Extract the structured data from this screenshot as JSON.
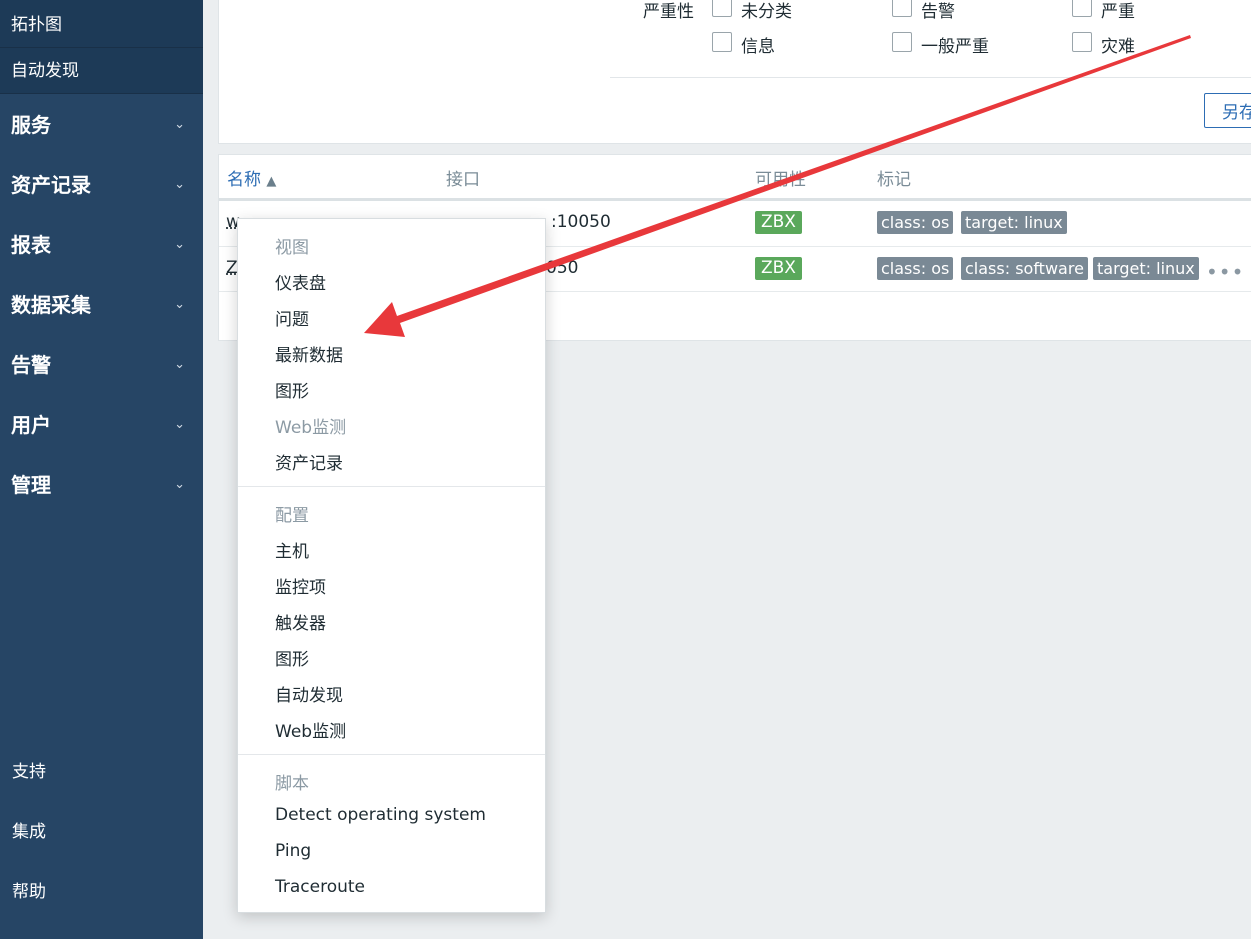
{
  "sidebar": {
    "sub_items": [
      "拓扑图",
      "自动发现"
    ],
    "nav_items": [
      "服务",
      "资产记录",
      "报表",
      "数据采集",
      "告警",
      "用户",
      "管理"
    ],
    "bottom_items": [
      "支持",
      "集成",
      "帮助"
    ]
  },
  "filter": {
    "severity_label": "严重性",
    "severities": [
      "未分类",
      "告警",
      "严重",
      "信息",
      "一般严重",
      "灾难"
    ],
    "save_as_label": "另存"
  },
  "table": {
    "headers": [
      "名称",
      "接口",
      "可用性",
      "标记"
    ],
    "sort_indicator": "▲",
    "rows": [
      {
        "name_fragment": "w",
        "interface": ":10050",
        "availability": "ZBX",
        "tags": [
          "class: os",
          "target: linux"
        ]
      },
      {
        "name_fragment": "Z",
        "interface": "050",
        "availability": "ZBX",
        "tags": [
          "class: os",
          "class: software",
          "target: linux"
        ],
        "more": "•••"
      }
    ]
  },
  "context_menu": {
    "sections": [
      {
        "header": "视图",
        "items": [
          "仪表盘",
          "问题",
          "最新数据",
          "图形",
          "Web监测",
          "资产记录"
        ],
        "disabled": [
          "Web监测"
        ]
      },
      {
        "header": "配置",
        "items": [
          "主机",
          "监控项",
          "触发器",
          "图形",
          "自动发现",
          "Web监测"
        ]
      },
      {
        "header": "脚本",
        "items": [
          "Detect operating system",
          "Ping",
          "Traceroute"
        ]
      }
    ]
  },
  "colors": {
    "sidebar_bg": "#264565",
    "accent_blue": "#2d6db4",
    "zbx_green": "#5aa85b",
    "tag_grey": "#7a8995",
    "annotation_red": "#e8383b"
  },
  "icons": {
    "chevron": "chevron-down-icon",
    "sort": "sort-ascending-icon",
    "more": "more-horizontal-icon"
  }
}
